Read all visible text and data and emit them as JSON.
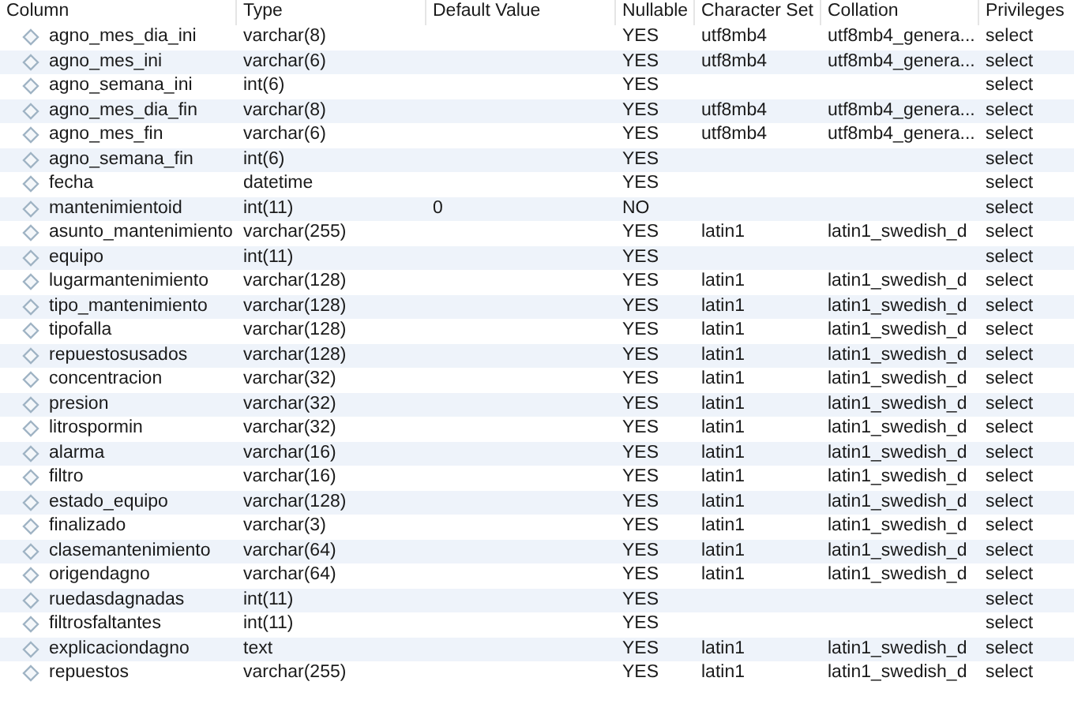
{
  "table": {
    "columns": [
      "Column",
      "Type",
      "Default Value",
      "Nullable",
      "Character Set",
      "Collation",
      "Privileges"
    ],
    "rows": [
      {
        "name": "agno_mes_dia_ini",
        "type": "varchar(8)",
        "nullable": "YES",
        "charset": "utf8mb4",
        "collation": "utf8mb4_genera...",
        "privileges": "select"
      },
      {
        "name": "agno_mes_ini",
        "type": "varchar(6)",
        "nullable": "YES",
        "charset": "utf8mb4",
        "collation": "utf8mb4_genera...",
        "privileges": "select"
      },
      {
        "name": "agno_semana_ini",
        "type": "int(6)",
        "nullable": "YES",
        "privileges": "select"
      },
      {
        "name": "agno_mes_dia_fin",
        "type": "varchar(8)",
        "nullable": "YES",
        "charset": "utf8mb4",
        "collation": "utf8mb4_genera...",
        "privileges": "select"
      },
      {
        "name": "agno_mes_fin",
        "type": "varchar(6)",
        "nullable": "YES",
        "charset": "utf8mb4",
        "collation": "utf8mb4_genera...",
        "privileges": "select"
      },
      {
        "name": "agno_semana_fin",
        "type": "int(6)",
        "nullable": "YES",
        "privileges": "select"
      },
      {
        "name": "fecha",
        "type": "datetime",
        "nullable": "YES",
        "privileges": "select"
      },
      {
        "name": "mantenimientoid",
        "type": "int(11)",
        "default": "0",
        "nullable": "NO",
        "privileges": "select"
      },
      {
        "name": "asunto_mantenimiento",
        "type": "varchar(255)",
        "nullable": "YES",
        "charset": "latin1",
        "collation": "latin1_swedish_d",
        "privileges": "select"
      },
      {
        "name": "equipo",
        "type": "int(11)",
        "nullable": "YES",
        "privileges": "select"
      },
      {
        "name": "lugarmantenimiento",
        "type": "varchar(128)",
        "nullable": "YES",
        "charset": "latin1",
        "collation": "latin1_swedish_d",
        "privileges": "select"
      },
      {
        "name": "tipo_mantenimiento",
        "type": "varchar(128)",
        "nullable": "YES",
        "charset": "latin1",
        "collation": "latin1_swedish_d",
        "privileges": "select"
      },
      {
        "name": "tipofalla",
        "type": "varchar(128)",
        "nullable": "YES",
        "charset": "latin1",
        "collation": "latin1_swedish_d",
        "privileges": "select"
      },
      {
        "name": "repuestosusados",
        "type": "varchar(128)",
        "nullable": "YES",
        "charset": "latin1",
        "collation": "latin1_swedish_d",
        "privileges": "select"
      },
      {
        "name": "concentracion",
        "type": "varchar(32)",
        "nullable": "YES",
        "charset": "latin1",
        "collation": "latin1_swedish_d",
        "privileges": "select"
      },
      {
        "name": "presion",
        "type": "varchar(32)",
        "nullable": "YES",
        "charset": "latin1",
        "collation": "latin1_swedish_d",
        "privileges": "select"
      },
      {
        "name": "litrospormin",
        "type": "varchar(32)",
        "nullable": "YES",
        "charset": "latin1",
        "collation": "latin1_swedish_d",
        "privileges": "select"
      },
      {
        "name": "alarma",
        "type": "varchar(16)",
        "nullable": "YES",
        "charset": "latin1",
        "collation": "latin1_swedish_d",
        "privileges": "select"
      },
      {
        "name": "filtro",
        "type": "varchar(16)",
        "nullable": "YES",
        "charset": "latin1",
        "collation": "latin1_swedish_d",
        "privileges": "select"
      },
      {
        "name": "estado_equipo",
        "type": "varchar(128)",
        "nullable": "YES",
        "charset": "latin1",
        "collation": "latin1_swedish_d",
        "privileges": "select"
      },
      {
        "name": "finalizado",
        "type": "varchar(3)",
        "nullable": "YES",
        "charset": "latin1",
        "collation": "latin1_swedish_d",
        "privileges": "select"
      },
      {
        "name": "clasemantenimiento",
        "type": "varchar(64)",
        "nullable": "YES",
        "charset": "latin1",
        "collation": "latin1_swedish_d",
        "privileges": "select"
      },
      {
        "name": "origendagno",
        "type": "varchar(64)",
        "nullable": "YES",
        "charset": "latin1",
        "collation": "latin1_swedish_d",
        "privileges": "select"
      },
      {
        "name": "ruedasdagnadas",
        "type": "int(11)",
        "nullable": "YES",
        "privileges": "select"
      },
      {
        "name": "filtrosfaltantes",
        "type": "int(11)",
        "nullable": "YES",
        "privileges": "select"
      },
      {
        "name": "explicaciondagno",
        "type": "text",
        "nullable": "YES",
        "charset": "latin1",
        "collation": "latin1_swedish_d",
        "privileges": "select"
      },
      {
        "name": "repuestos",
        "type": "varchar(255)",
        "nullable": "YES",
        "charset": "latin1",
        "collation": "latin1_swedish_d",
        "privileges": "select"
      }
    ]
  }
}
